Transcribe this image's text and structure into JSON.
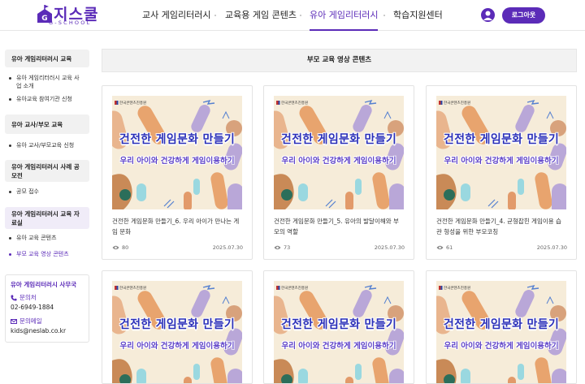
{
  "header": {
    "logo_text": "지스쿨",
    "logo_sub": "G-SCHOOL",
    "nav": [
      "교사 게임리터러시",
      "교육용 게임 콘텐츠",
      "유아 게임리터러시",
      "학습지원센터"
    ],
    "logout": "로그아웃",
    "accent": "#5b2bb8"
  },
  "sidebar": {
    "groups": [
      {
        "label": "유아 게임리터러시 교육",
        "items": [
          "유아 게임리터러시 교육 사업 소개",
          "유아교육 참여기관 신청"
        ]
      },
      {
        "label": "유아 교사/부모 교육",
        "items": [
          "유아 교사/부모교육 신청"
        ]
      },
      {
        "label": "유아 게임리터러시 사례 공모전",
        "items": [
          "공모 접수"
        ]
      },
      {
        "label": "유아 게임리터러시 교육 자료실",
        "items": [
          "유아 교육 콘텐츠",
          "부모 교육 영상 콘텐츠"
        ]
      }
    ],
    "contact": {
      "title": "유아 게임리터러시 사무국",
      "phone_label": "문의처",
      "phone": "02-6949-1884",
      "email_label": "문의메일",
      "email": "kids@neslab.co.kr"
    }
  },
  "main": {
    "title": "부모 교육 영상 콘텐츠",
    "thumb_brand": "한국콘텐츠진흥원",
    "thumb_title": "건전한 게임문화 만들기",
    "thumb_sub": "우리 아이와 건강하게 게임이용하기",
    "cards": [
      {
        "title": "건전한 게임문화 만들기_6. 우리 아이가 만나는 게임 문화",
        "views": "80",
        "date": "2025.07.30"
      },
      {
        "title": "건전한 게임문화 만들기_5. 유아의 발달이해와 부모의 역할",
        "views": "73",
        "date": "2025.07.30"
      },
      {
        "title": "건전한 게임문화 만들기_4. 균형잡힌 게임이용 습관 형성을 위한 부모코칭",
        "views": "61",
        "date": "2025.07.30"
      },
      {
        "title": "",
        "views": "",
        "date": ""
      },
      {
        "title": "",
        "views": "",
        "date": ""
      },
      {
        "title": "",
        "views": "",
        "date": ""
      }
    ]
  }
}
